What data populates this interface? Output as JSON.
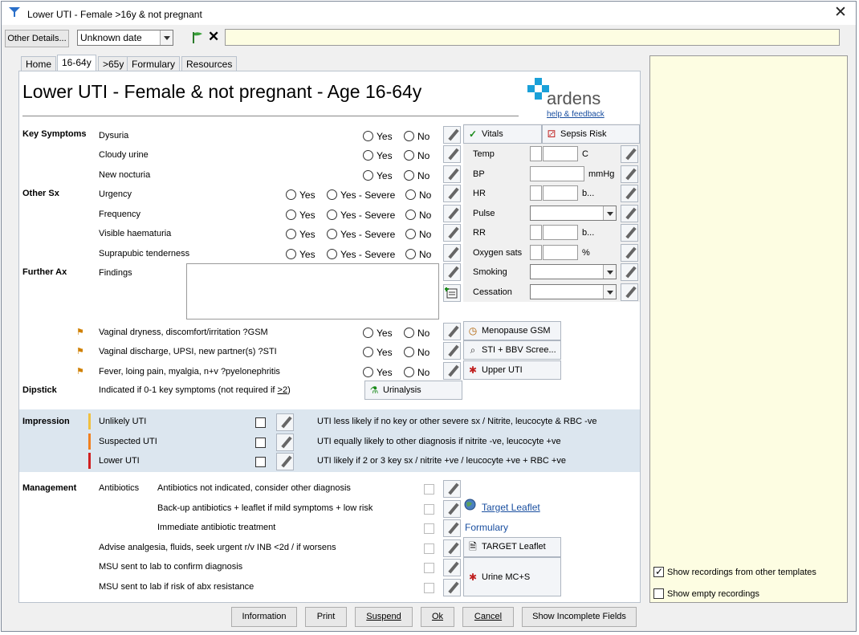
{
  "window": {
    "title": "Lower UTI - Female >16y & not pregnant",
    "close_glyph": "✕"
  },
  "toolbar": {
    "other_details": "Other Details...",
    "date_value": "Unknown date",
    "clear_glyph": "✕",
    "text_value": ""
  },
  "tabs": [
    {
      "label": "Home"
    },
    {
      "label": "16-64y",
      "active": true
    },
    {
      "label": ">65y"
    },
    {
      "label": "Formulary"
    },
    {
      "label": "Resources"
    }
  ],
  "form": {
    "heading": "Lower UTI - Female & not pregnant - Age 16-64y",
    "brand": "ardens",
    "help_link": "help & feedback",
    "opt_yes": "Yes",
    "opt_no": "No",
    "opt_severe": "Yes - Severe",
    "sections": {
      "key_symptoms": "Key Symptoms",
      "other_sx": "Other Sx",
      "further_ax": "Further Ax",
      "dipstick": "Dipstick",
      "impression": "Impression",
      "management": "Management"
    },
    "key_symptoms": [
      "Dysuria",
      "Cloudy urine",
      "New nocturia"
    ],
    "other_sx": [
      "Urgency",
      "Frequency",
      "Visible haematuria",
      "Suprapubic tenderness"
    ],
    "findings_label": "Findings",
    "flagged": [
      {
        "label": "Vaginal dryness, discomfort/irritation ?GSM",
        "button": "Menopause GSM"
      },
      {
        "label": "Vaginal discharge, UPSI, new partner(s) ?STI",
        "button": "STI + BBV Scree..."
      },
      {
        "label": "Fever, loing pain, myalgia, n+v ?pyelonephritis",
        "button": "Upper UTI"
      }
    ],
    "dipstick_text_a": "Indicated if 0-1 key symptoms (not required if ",
    "dipstick_text_b": ">2",
    "dipstick_text_c": ")",
    "urinalysis": "Urinalysis",
    "impression": [
      {
        "label": "Unlikely UTI",
        "note": "UTI less likely if no key or other severe sx / Nitrite, leucocyte & RBC -ve",
        "color": "#f0c040"
      },
      {
        "label": "Suspected UTI",
        "note": "UTI equally likely to other diagnosis if nitrite -ve, leucocyte +ve",
        "color": "#f08020"
      },
      {
        "label": "Lower UTI",
        "note": "UTI likely if 2 or 3 key sx / nitrite +ve / leucocyte +ve + RBC +ve",
        "color": "#d02020"
      }
    ],
    "antibiotics_label": "Antibiotics",
    "management": [
      "Antibiotics not indicated, consider other diagnosis",
      "Back-up antibiotics + leaflet if mild symptoms + low risk",
      "Immediate antibiotic treatment",
      "Advise analgesia, fluids, seek urgent r/v INB <2d / if worsens",
      "MSU sent to lab to confirm diagnosis",
      "MSU sent to lab if risk of abx resistance"
    ],
    "target_leaflet_link": "Target Leaflet",
    "formulary_link": "Formulary",
    "target_leaflet_btn": "TARGET Leaflet",
    "urine_btn": "Urine MC+S"
  },
  "vitals": {
    "vitals_tab": "Vitals",
    "sepsis_tab": "Sepsis Risk",
    "rows": [
      {
        "label": "Temp",
        "unit": "C"
      },
      {
        "label": "BP",
        "unit": "mmHg"
      },
      {
        "label": "HR",
        "unit": "b..."
      },
      {
        "label": "Pulse",
        "unit": ""
      },
      {
        "label": "RR",
        "unit": "b..."
      },
      {
        "label": "Oxygen sats",
        "unit": "%"
      },
      {
        "label": "Smoking",
        "unit": ""
      },
      {
        "label": "Cessation",
        "unit": ""
      }
    ]
  },
  "right_pane": {
    "show_other": "Show recordings from other templates",
    "show_other_checked": true,
    "show_empty": "Show empty recordings",
    "show_empty_checked": false
  },
  "footer": {
    "information": "Information",
    "print": "Print",
    "suspend": "Suspend",
    "ok": "Ok",
    "cancel": "Cancel",
    "show_incomplete": "Show Incomplete Fields"
  },
  "colors": {
    "accent": "#1a4fa0",
    "right_pane_bg": "#fdfde2",
    "impression_bg": "#dce6ef"
  }
}
